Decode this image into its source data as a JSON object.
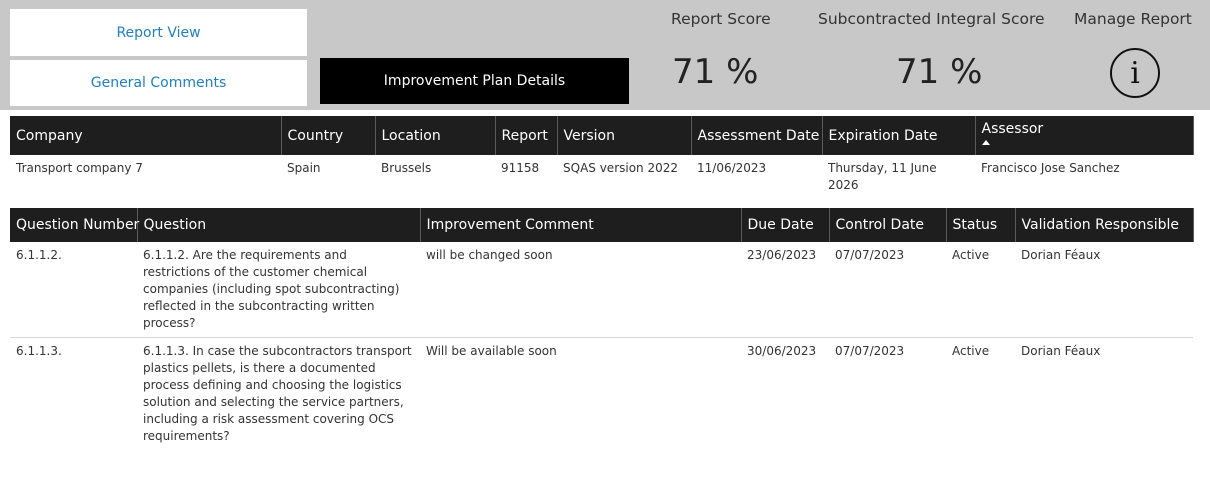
{
  "nav": {
    "report_view": "Report View",
    "general_comments": "General Comments",
    "improvement_plan": "Improvement Plan Details"
  },
  "kpis": {
    "report_score_label": "Report Score",
    "report_score_value": "71 %",
    "integral_score_label": "Subcontracted Integral Score",
    "integral_score_value": "71 %",
    "manage_label": "Manage Report",
    "info_icon": "i"
  },
  "report_table": {
    "headers": [
      "Company",
      "Country",
      "Location",
      "Report",
      "Version",
      "Assessment Date",
      "Expiration Date",
      "Assessor"
    ],
    "row": {
      "company": "Transport company 7",
      "country": "Spain",
      "location": "Brussels",
      "report": "91158",
      "version": "SQAS version 2022",
      "assessment_date": "11/06/2023",
      "expiration_date": "Thursday, 11 June 2026",
      "assessor": "Francisco Jose Sanchez"
    }
  },
  "plan_table": {
    "headers": [
      "Question Number",
      "Question",
      "Improvement Comment",
      "Due Date",
      "Control Date",
      "Status",
      "Validation Responsible"
    ],
    "rows": [
      {
        "number": "6.1.1.2.",
        "question": "6.1.1.2. Are the requirements and restrictions of the customer chemical companies (including spot subcontracting) reflected in the subcontracting written process?",
        "comment": "will be changed soon",
        "due": "23/06/2023",
        "control": "07/07/2023",
        "status": "Active",
        "responsible": "Dorian Féaux"
      },
      {
        "number": "6.1.1.3.",
        "question": "6.1.1.3. In case the subcontractors transport plastics pellets, is there a documented process defining and choosing the logistics solution and selecting the service partners, including a risk assessment covering OCS requirements?",
        "comment": "Will be available soon",
        "due": "30/06/2023",
        "control": "07/07/2023",
        "status": "Active",
        "responsible": "Dorian Féaux"
      }
    ]
  },
  "colors": {
    "header_bg": "#1e1e1e",
    "top_band": "#c8c8c8",
    "link_blue": "#1f7fbf",
    "active_button_bg": "#000000"
  }
}
